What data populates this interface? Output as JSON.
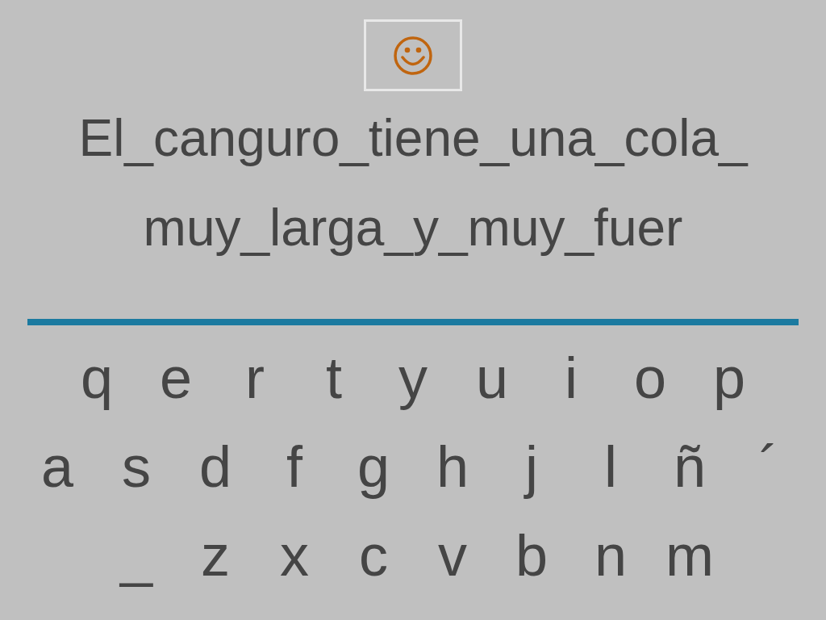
{
  "sentence_lines": [
    "El_canguro_tiene_una_cola_",
    "muy_larga_y_muy_fuer"
  ],
  "keyboard_rows": [
    [
      "q",
      "e",
      "r",
      "t",
      "y",
      "u",
      "i",
      "o",
      "p"
    ],
    [
      "a",
      "s",
      "d",
      "f",
      "g",
      "h",
      "j",
      "l",
      "ñ",
      "´"
    ],
    [
      "_",
      "z",
      "x",
      "c",
      "v",
      "b",
      "n",
      "m"
    ]
  ]
}
